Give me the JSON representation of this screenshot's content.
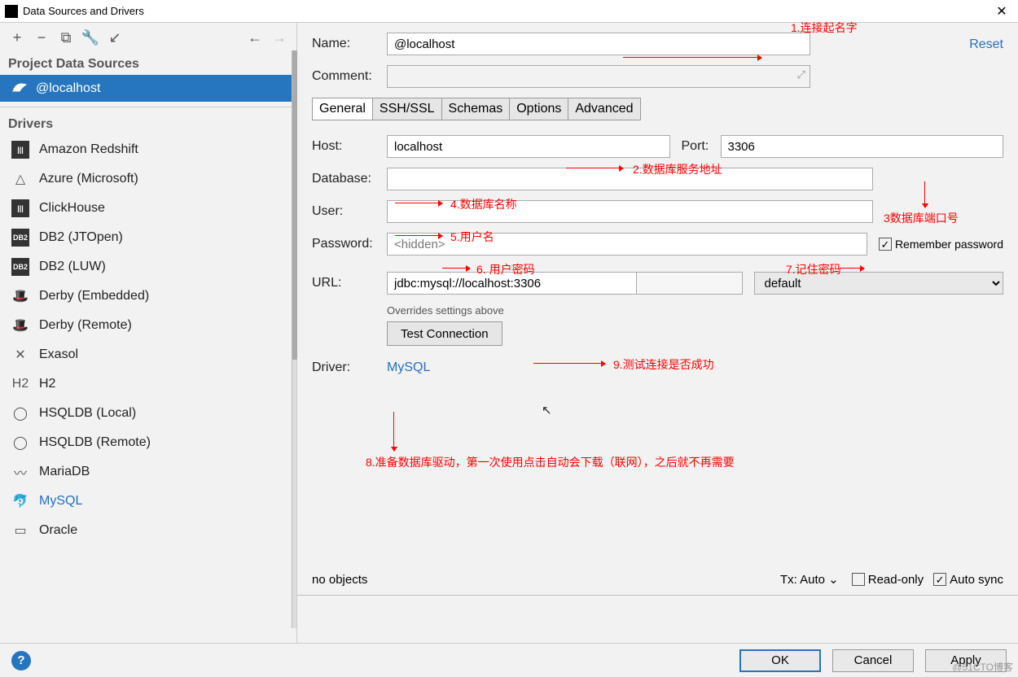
{
  "window": {
    "title": "Data Sources and Drivers"
  },
  "toolbar_icons": {
    "add": "+",
    "remove": "−",
    "copy": "⧉",
    "wrench": "🔧",
    "import": "↙",
    "back": "←",
    "fwd": "→"
  },
  "sidebar": {
    "project_header": "Project Data Sources",
    "datasource": {
      "label": "@localhost"
    },
    "drivers_header": "Drivers",
    "drivers": [
      {
        "label": "Amazon Redshift",
        "glyph": "|||"
      },
      {
        "label": "Azure (Microsoft)",
        "glyph": "△"
      },
      {
        "label": "ClickHouse",
        "glyph": "|||"
      },
      {
        "label": "DB2 (JTOpen)",
        "glyph": "DB2"
      },
      {
        "label": "DB2 (LUW)",
        "glyph": "DB2"
      },
      {
        "label": "Derby (Embedded)",
        "glyph": "🎩"
      },
      {
        "label": "Derby (Remote)",
        "glyph": "🎩"
      },
      {
        "label": "Exasol",
        "glyph": "✕"
      },
      {
        "label": "H2",
        "glyph": "H2"
      },
      {
        "label": "HSQLDB (Local)",
        "glyph": "◯"
      },
      {
        "label": "HSQLDB (Remote)",
        "glyph": "◯"
      },
      {
        "label": "MariaDB",
        "glyph": "〰"
      },
      {
        "label": "MySQL",
        "glyph": "🐬",
        "selected": true
      },
      {
        "label": "Oracle",
        "glyph": "▭"
      }
    ]
  },
  "form": {
    "reset": "Reset",
    "name_label": "Name:",
    "name_value": "@localhost",
    "comment_label": "Comment:",
    "tabs": [
      "General",
      "SSH/SSL",
      "Schemas",
      "Options",
      "Advanced"
    ],
    "host_label": "Host:",
    "host_value": "localhost",
    "port_label": "Port:",
    "port_value": "3306",
    "database_label": "Database:",
    "database_value": "",
    "user_label": "User:",
    "user_value": "",
    "password_label": "Password:",
    "password_placeholder": "<hidden>",
    "remember_label": "Remember password",
    "url_label": "URL:",
    "url_value": "jdbc:mysql://localhost:3306",
    "url_mode": "default",
    "overrides": "Overrides settings above",
    "test_btn": "Test Connection",
    "driver_label": "Driver:",
    "driver_value": "MySQL"
  },
  "status": {
    "no_objects": "no objects",
    "tx": "Tx: Auto",
    "readonly": "Read-only",
    "autosync": "Auto sync"
  },
  "buttons": {
    "ok": "OK",
    "cancel": "Cancel",
    "apply": "Apply"
  },
  "annotations": {
    "a1": "1.连接起名字",
    "a2": "2.数据库服务地址",
    "a3": "3数据库端口号",
    "a4": "4.数据库名称",
    "a5": "5.用户名",
    "a6": "6. 用户密码",
    "a7": "7.记住密码",
    "a8": "8.准备数据库驱动，第一次使用点击自动会下载（联网），之后就不再需要",
    "a9": "9.测试连接是否成功"
  },
  "watermark": "@51CTO博客"
}
